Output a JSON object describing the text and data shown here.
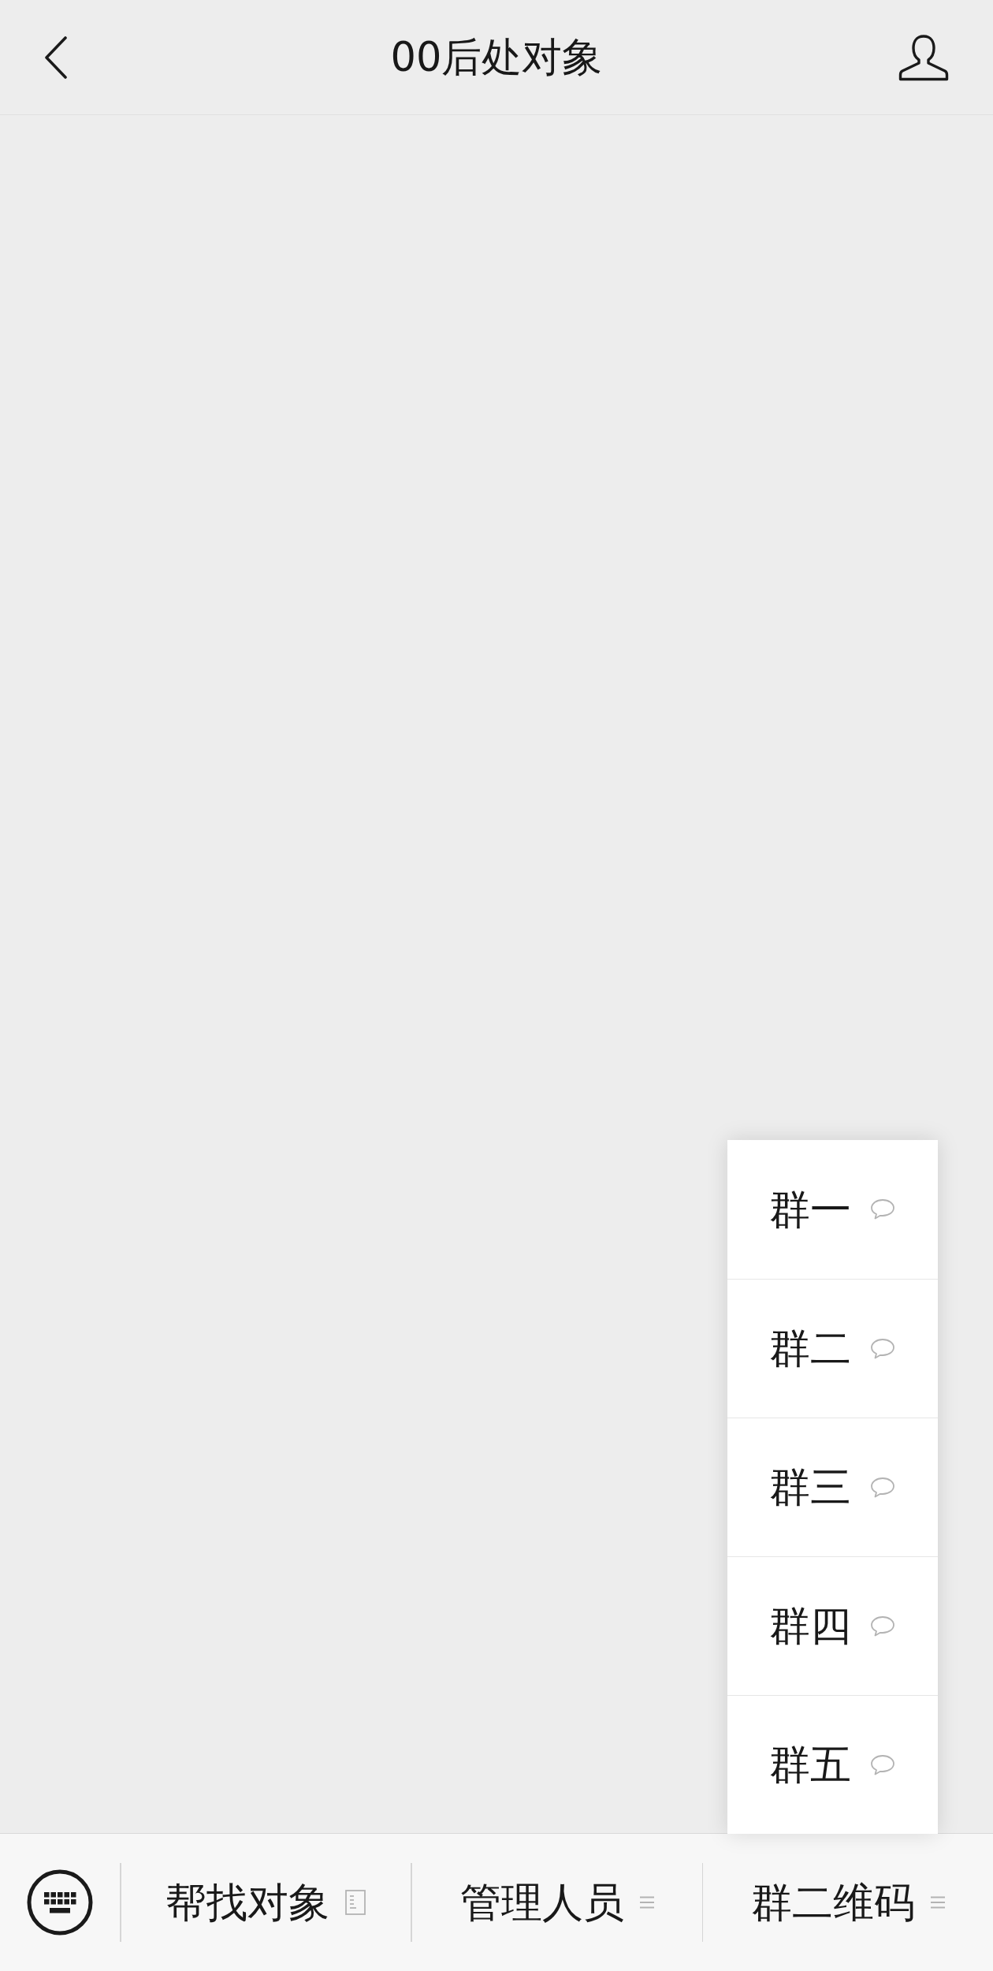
{
  "navigation_bar": {
    "title": "00后处对象"
  },
  "bottom_menu": {
    "items": [
      {
        "label": "帮找对象",
        "kind": "link"
      },
      {
        "label": "管理人员",
        "kind": "submenu"
      },
      {
        "label": "群二维码",
        "kind": "submenu",
        "children": [
          {
            "label": "群一"
          },
          {
            "label": "群二"
          },
          {
            "label": "群三"
          },
          {
            "label": "群四"
          },
          {
            "label": "群五"
          }
        ]
      }
    ]
  }
}
